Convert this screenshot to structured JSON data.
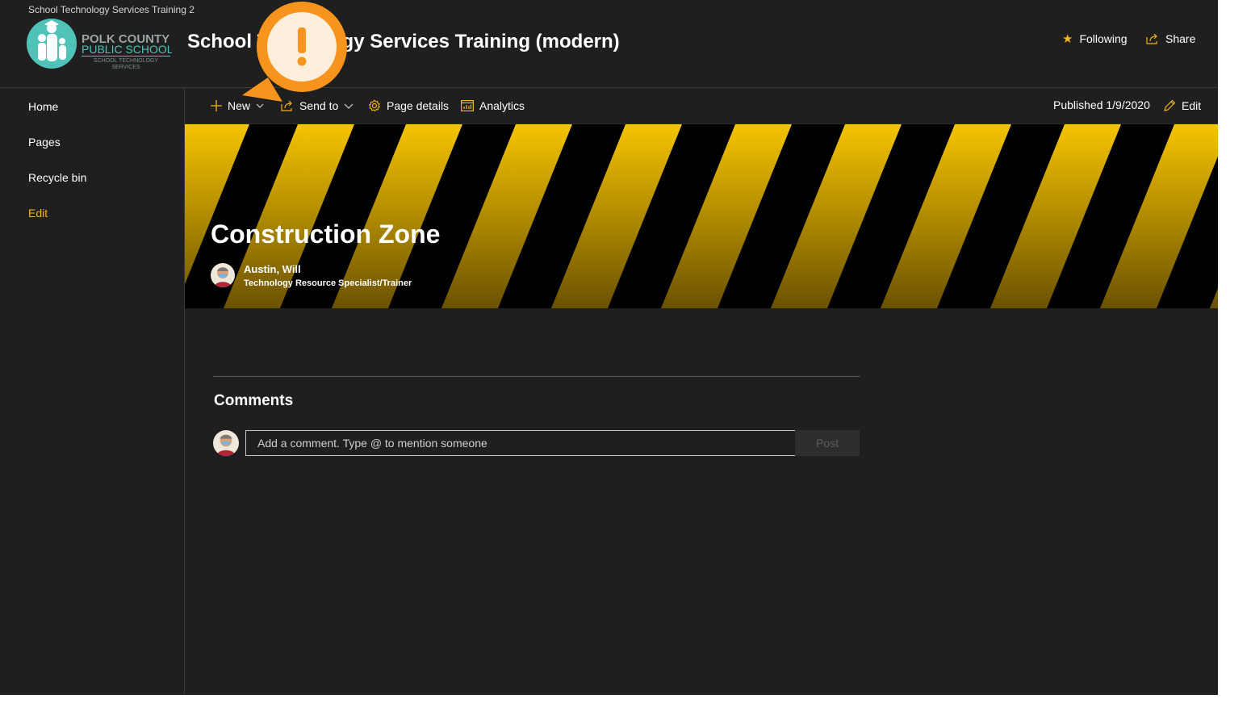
{
  "header": {
    "hub_name": "School Technology Services Training 2",
    "site_title": "School Technology Services Training (modern)",
    "following_label": "Following",
    "share_label": "Share",
    "logo": {
      "line1": "POLK COUNTY",
      "line2": "PUBLIC SCHOOLS",
      "line3": "SCHOOL TECHNOLOGY",
      "line4": "SERVICES"
    }
  },
  "nav": {
    "items": [
      {
        "label": "Home"
      },
      {
        "label": "Pages"
      },
      {
        "label": "Recycle bin"
      },
      {
        "label": "Edit"
      }
    ]
  },
  "command_bar": {
    "new_label": "New",
    "send_to_label": "Send to",
    "page_details_label": "Page details",
    "analytics_label": "Analytics",
    "published_label": "Published 1/9/2020",
    "edit_label": "Edit"
  },
  "hero": {
    "title": "Construction Zone",
    "author_name": "Austin, Will",
    "author_title": "Technology Resource Specialist/Trainer"
  },
  "comments": {
    "heading": "Comments",
    "input_placeholder": "Add a comment. Type @ to mention someone",
    "post_label": "Post"
  },
  "colors": {
    "background": "#1f1f1f",
    "accent": "#f4b31f",
    "stripe_yellow": "#f5c400",
    "alert_orange": "#f7941d",
    "logo_teal": "#4fc3b7"
  },
  "icons": [
    "star-icon",
    "share-icon",
    "plus-icon",
    "chevron-down-icon",
    "send-icon",
    "gear-icon",
    "analytics-icon",
    "pencil-icon",
    "alert-icon"
  ]
}
